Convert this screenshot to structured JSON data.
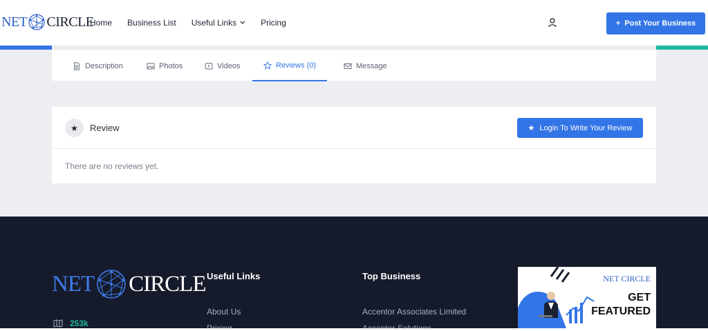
{
  "header": {
    "logo_left": "NET",
    "logo_right": "CIRCLE",
    "nav": [
      "Home",
      "Business List",
      "Useful Links",
      "Pricing"
    ],
    "post_button": "Post Your Business",
    "post_button_icon": "+"
  },
  "tabs": [
    {
      "label": "Description",
      "icon": "document-icon"
    },
    {
      "label": "Photos",
      "icon": "image-icon"
    },
    {
      "label": "Videos",
      "icon": "video-icon"
    },
    {
      "label": "Reviews (0)",
      "icon": "star-outline-icon",
      "active": true
    },
    {
      "label": "Message",
      "icon": "mail-icon"
    }
  ],
  "review": {
    "title": "Review",
    "login_button": "Login To Write Your Review",
    "empty_text": "There are no reviews yet."
  },
  "footer": {
    "logo_left": "NET",
    "logo_right": "CIRCLE",
    "stat_value": "253k",
    "useful_links_heading": "Useful Links",
    "useful_links": [
      "About Us",
      "Pricing"
    ],
    "top_business_heading": "Top Business",
    "top_business": [
      "Accentor Associates Limited",
      "Accentor Solutions"
    ],
    "ad": {
      "logo": "NET CIRCLE",
      "line1": "GET",
      "line2": "FEATURED"
    }
  },
  "colors": {
    "primary": "#3375e6",
    "teal": "#1fb79e",
    "footer_bg": "#161b2b"
  }
}
